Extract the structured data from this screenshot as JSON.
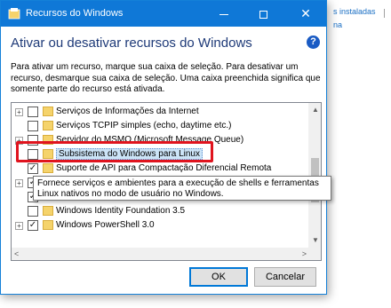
{
  "background": {
    "link1": "s instaladas",
    "link2": "na"
  },
  "window": {
    "title": "Recursos do Windows",
    "heading": "Ativar ou desativar recursos do Windows",
    "description": "Para ativar um recurso, marque sua caixa de seleção. Para desativar um recurso, desmarque sua caixa de seleção. Uma caixa preenchida significa que somente parte do recurso está ativada.",
    "help": "?",
    "title_buttons": {
      "minimize": "",
      "maximize": "",
      "close": "✕"
    }
  },
  "tree": {
    "items": [
      {
        "label": "Serviços de Informações da Internet",
        "expandable": true,
        "checked": false
      },
      {
        "label": "Serviços TCPIP simples (echo, daytime etc.)",
        "expandable": false,
        "checked": false
      },
      {
        "label": "Servidor do MSMQ (Microsoft Message Queue)",
        "expandable": true,
        "checked": false
      },
      {
        "label": "Subsistema do Windows para Linux",
        "expandable": false,
        "checked": false,
        "selected": true
      },
      {
        "label": "Suporte de API para Compactação Diferencial Remota",
        "expandable": false,
        "checked": true
      },
      {
        "label": "",
        "expandable": true,
        "checked": true
      },
      {
        "label": "",
        "expandable": false,
        "checked": true
      },
      {
        "label": "Windows Identity Foundation 3.5",
        "expandable": false,
        "checked": false
      },
      {
        "label": "Windows PowerShell 3.0",
        "expandable": true,
        "checked": true
      }
    ],
    "scroll_up": "▲",
    "scroll_down": "▼",
    "scroll_left": "<",
    "scroll_right": ">"
  },
  "tooltip": {
    "text": "Fornece serviços e ambientes para a execução de shells e ferramentas Linux nativos no modo de usuário no Windows."
  },
  "buttons": {
    "ok": "OK",
    "cancel": "Cancelar"
  },
  "colors": {
    "titlebar": "#0f78d7",
    "heading": "#1e3a78",
    "highlight": "#e0141e",
    "folder": "#f5d36b"
  }
}
